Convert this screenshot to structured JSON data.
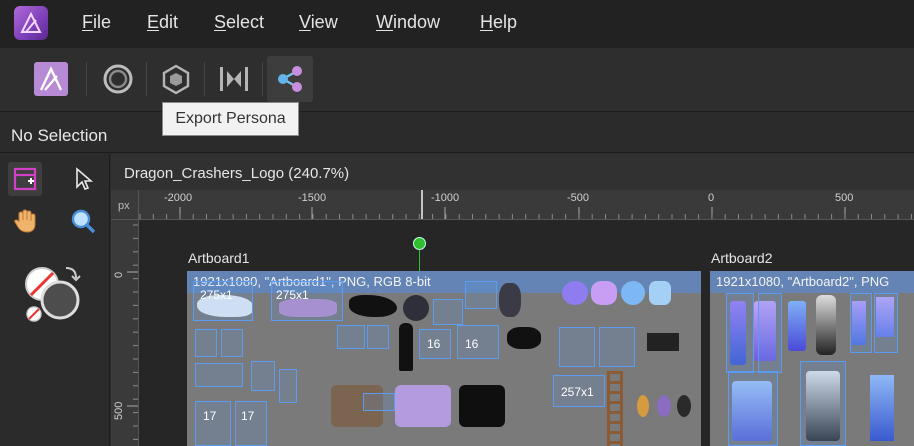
{
  "menu": {
    "items": [
      {
        "id": "file",
        "underline": "F",
        "rest": "ile"
      },
      {
        "id": "edit",
        "underline": "E",
        "rest": "dit"
      },
      {
        "id": "select",
        "underline": "S",
        "rest": "elect"
      },
      {
        "id": "view",
        "underline": "V",
        "rest": "iew"
      },
      {
        "id": "window",
        "underline": "W",
        "rest": "indow"
      },
      {
        "id": "help",
        "underline": "H",
        "rest": "elp"
      }
    ]
  },
  "toolbar": {
    "tooltip": "Export Persona",
    "personas": [
      "designer-persona-icon",
      "pixel-persona-icon",
      "export-persona-icon",
      "photo-persona-icon",
      "share-icon"
    ]
  },
  "context": {
    "selection_text": "No Selection"
  },
  "document": {
    "title": "Dragon_Crashers_Logo (240.7%)",
    "ruler_unit": "px",
    "ruler_top_labels": [
      "-2000",
      "-1500",
      "-1000",
      "-500",
      "0",
      "500"
    ],
    "ruler_left_labels": [
      "0",
      "500"
    ]
  },
  "artboards": [
    {
      "label": "Artboard1",
      "info": "1921x1080, \"Artboard1\", PNG, RGB 8-bit",
      "slice_labels": [
        "275x1",
        "275x1",
        "16",
        "16",
        "17",
        "17",
        "257x1"
      ]
    },
    {
      "label": "Artboard2",
      "info": "1921x1080, \"Artboard2\", PNG"
    }
  ],
  "colors": {
    "menubar_bg": "#222222",
    "toolbar_bg": "#2e2e2e",
    "canvas_bg": "#262626",
    "artboard_bg": "#7a7a7a",
    "slice_accent": "#5b9cf0",
    "brand_purple": "#9b57d3",
    "add_artboard_pink": "#d340c8",
    "selection_handle_green": "#2fbf2f"
  }
}
